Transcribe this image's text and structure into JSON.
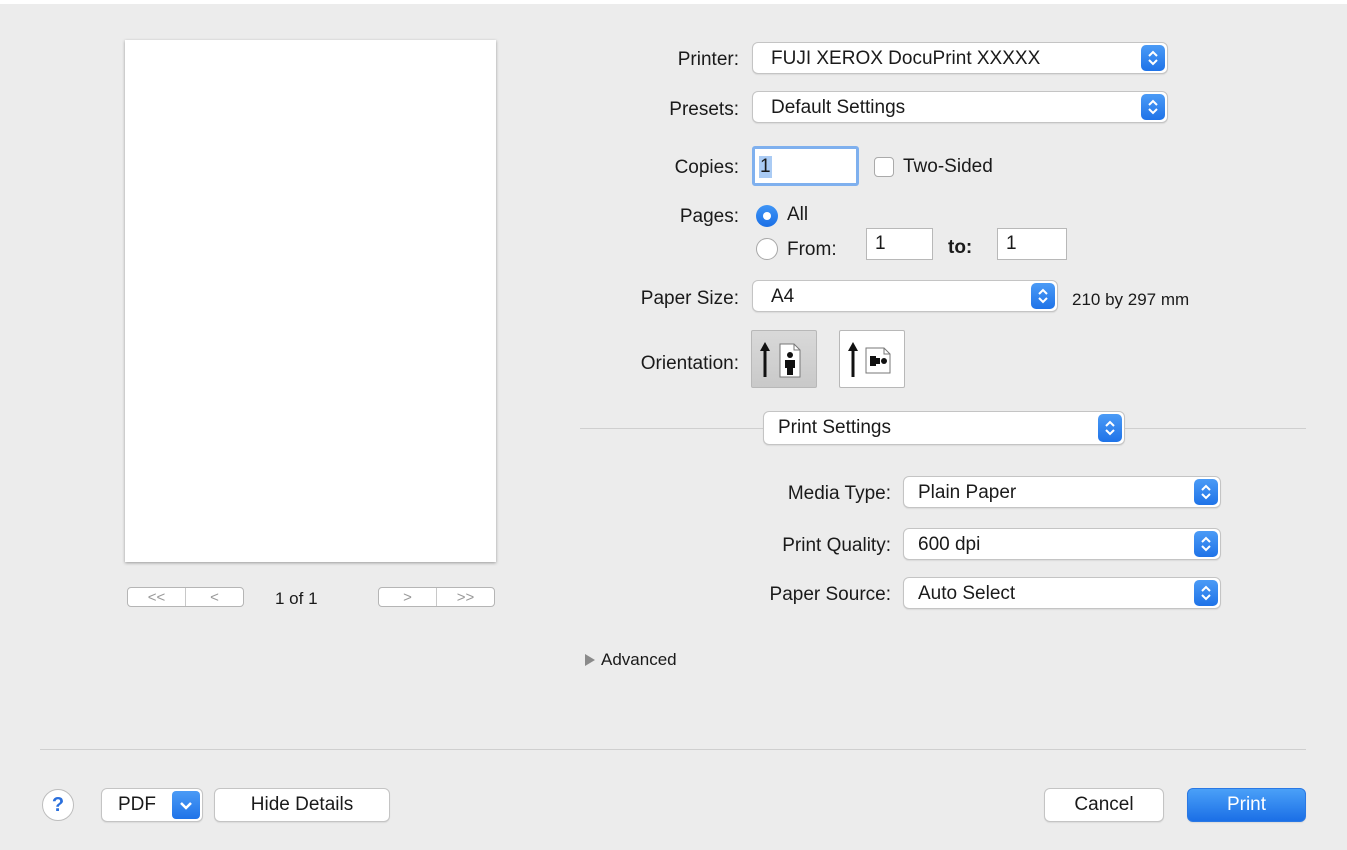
{
  "preview": {
    "page_indicator": "1 of 1",
    "nav_first": "<<",
    "nav_prev": "<",
    "nav_next": ">",
    "nav_last": ">>"
  },
  "printer": {
    "label": "Printer:",
    "value": "FUJI XEROX DocuPrint XXXXX"
  },
  "presets": {
    "label": "Presets:",
    "value": "Default Settings"
  },
  "copies": {
    "label": "Copies:",
    "value": "1",
    "two_sided_label": "Two-Sided",
    "two_sided_checked": false
  },
  "pages": {
    "label": "Pages:",
    "all_label": "All",
    "from_label": "From:",
    "from_value": "1",
    "to_label": "to:",
    "to_value": "1",
    "selected": "All"
  },
  "paper_size": {
    "label": "Paper Size:",
    "value": "A4",
    "dimensions": "210 by 297 mm"
  },
  "orientation": {
    "label": "Orientation:",
    "selected": "portrait"
  },
  "section_popup": {
    "value": "Print Settings"
  },
  "media_type": {
    "label": "Media Type:",
    "value": "Plain Paper"
  },
  "print_quality": {
    "label": "Print Quality:",
    "value": "600 dpi"
  },
  "paper_source": {
    "label": "Paper Source:",
    "value": "Auto Select"
  },
  "advanced": {
    "label": "Advanced"
  },
  "footer": {
    "help": "?",
    "pdf": "PDF",
    "hide_details": "Hide Details",
    "cancel": "Cancel",
    "print": "Print"
  },
  "colors": {
    "accent": "#1f73e8",
    "background": "#ececec"
  }
}
